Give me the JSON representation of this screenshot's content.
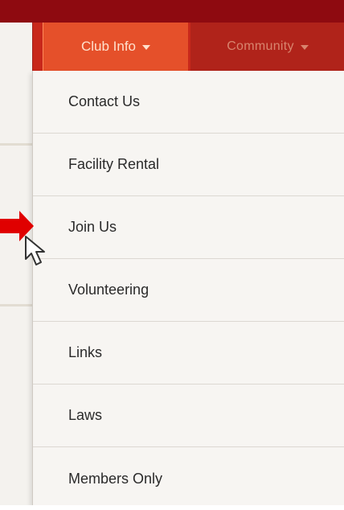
{
  "nav": {
    "items": [
      {
        "label": "Club Info",
        "active": true
      },
      {
        "label": "Community",
        "active": false
      }
    ]
  },
  "dropdown": {
    "items": [
      {
        "label": "Contact Us"
      },
      {
        "label": "Facility Rental"
      },
      {
        "label": "Join Us"
      },
      {
        "label": "Volunteering"
      },
      {
        "label": "Links"
      },
      {
        "label": "Laws"
      },
      {
        "label": "Members Only"
      }
    ]
  },
  "icons": {
    "caret": "chevron-down-icon",
    "arrow": "red-arrow-icon",
    "cursor": "mouse-pointer-icon"
  },
  "colors": {
    "top_band": "#8e0a10",
    "nav_bar": "#c8281b",
    "active_tab": "#e5502a",
    "dropdown_bg": "#f7f5f2",
    "arrow": "#e00000"
  }
}
